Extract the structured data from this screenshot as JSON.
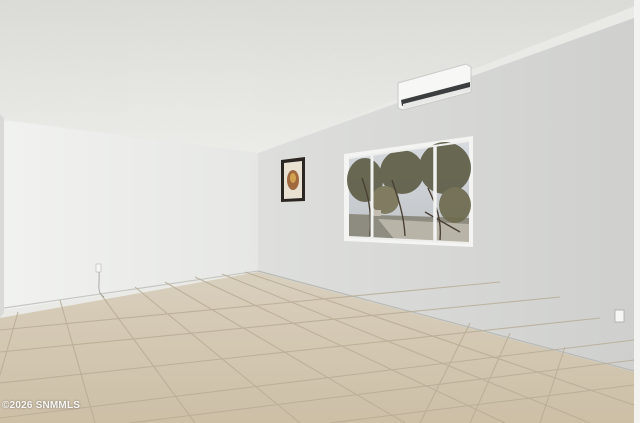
{
  "photo": {
    "watermark": "©2026 SNMMLS",
    "colors": {
      "ceiling": "#e4e4e0",
      "left_wall": "#ecedeb",
      "right_wall": "#dadbd9",
      "floor_tile": "#d3c7b1",
      "grout": "#b7ab96",
      "window_frame": "#f4f4f2",
      "trees": "#6f6a52"
    },
    "objects": [
      "ceiling",
      "left-wall",
      "right-wall",
      "tile-floor",
      "mini-split-ac-unit",
      "framed-picture",
      "window",
      "power-outlet"
    ]
  }
}
